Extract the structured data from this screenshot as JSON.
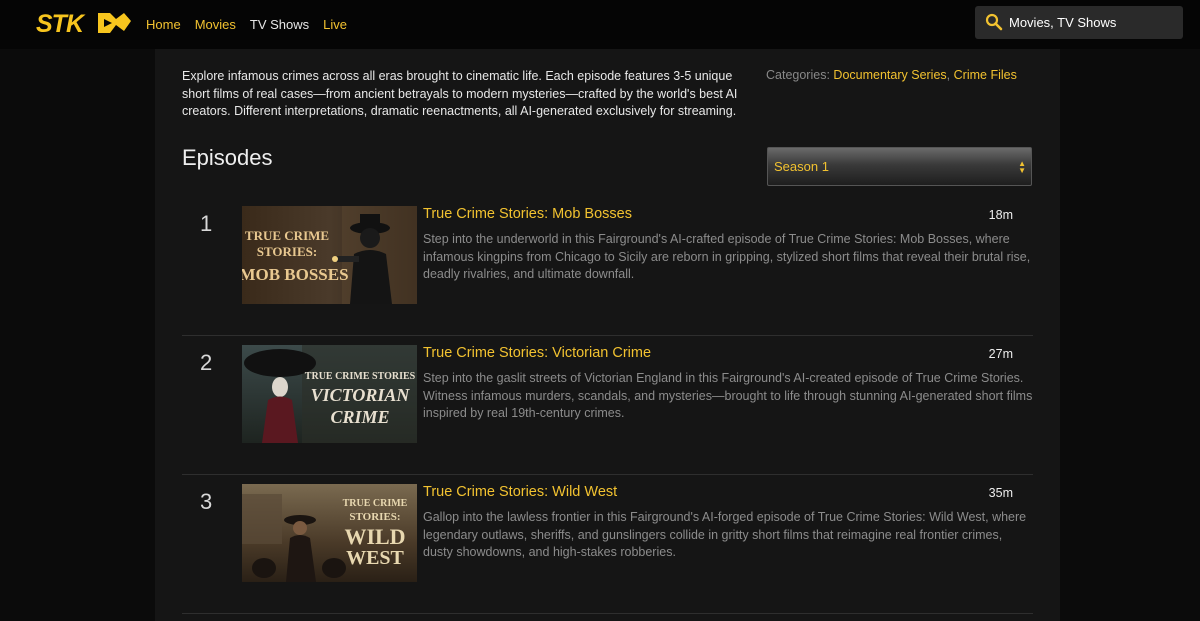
{
  "header": {
    "logo_text": "STKD",
    "nav": [
      {
        "label": "Home",
        "active": true
      },
      {
        "label": "Movies",
        "active": true
      },
      {
        "label": "TV Shows",
        "active": false
      },
      {
        "label": "Live",
        "active": true
      }
    ],
    "search": {
      "value": "Movies, TV Shows",
      "icon": "search-icon"
    }
  },
  "series": {
    "description": "Explore infamous crimes across all eras brought to cinematic life. Each episode features 3-5 unique short films of real cases—from ancient betrayals to modern mysteries—crafted by the world's best AI creators. Different interpretations, dramatic reenactments, all AI-generated exclusively for streaming.",
    "categories_label": "Categories:",
    "categories": [
      "Documentary Series",
      "Crime Files"
    ],
    "categories_separator": ","
  },
  "episodes_title": "Episodes",
  "season_select": {
    "selected": "Season 1"
  },
  "episodes": [
    {
      "number": "1",
      "title": "True Crime Stories: Mob Bosses",
      "duration": "18m",
      "description": "Step into the underworld in this Fairground's AI-crafted episode of True Crime Stories: Mob Bosses, where infamous kingpins from Chicago to Sicily are reborn in gripping, stylized short films that reveal their brutal rise, deadly rivalries, and ultimate downfall.",
      "thumb_lines": [
        "TRUE CRIME",
        "STORIES:",
        "MOB BOSSES"
      ]
    },
    {
      "number": "2",
      "title": "True Crime Stories: Victorian Crime",
      "duration": "27m",
      "description": "Step into the gaslit streets of Victorian England in this Fairground's AI-created episode of True Crime Stories. Witness infamous murders, scandals, and mysteries—brought to life through stunning AI-generated short films inspired by real 19th-century crimes.",
      "thumb_lines": [
        "TRUE CRIME STORIES",
        "VICTORIAN",
        "CRIME"
      ]
    },
    {
      "number": "3",
      "title": "True Crime Stories: Wild West",
      "duration": "35m",
      "description": "Gallop into the lawless frontier in this Fairground's AI-forged episode of True Crime Stories: Wild West, where legendary outlaws, sheriffs, and gunslingers collide in gritty short films that reimagine real frontier crimes, dusty showdowns, and high-stakes robberies.",
      "thumb_lines": [
        "TRUE CRIME",
        "STORIES:",
        "WILD",
        "WEST"
      ]
    }
  ],
  "colors": {
    "accent": "#f2c230",
    "background": "#151515",
    "topbar": "#050505"
  }
}
